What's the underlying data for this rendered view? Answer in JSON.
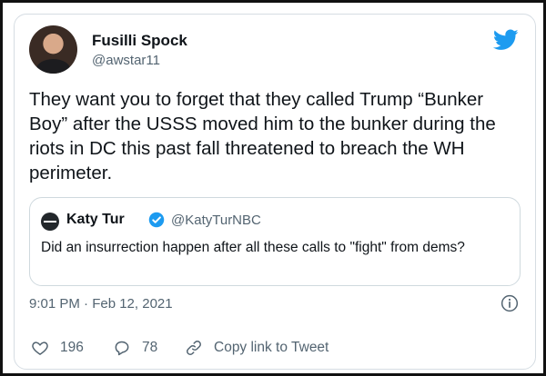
{
  "colors": {
    "brand": "#1d9bf0",
    "verified": "#1d9bf0",
    "secondary_text": "#536471",
    "border": "#cfd9de"
  },
  "tweet": {
    "author_name": "Fusilli Spock",
    "author_handle": "@awstar11",
    "avatar_icon": "avatar",
    "brand_icon": "twitter-bird-icon",
    "text": "They want you to forget that they called Trump “Bunker Boy” after the USSS moved him to the bunker during the riots in DC this past fall threatened to breach the WH perimeter.",
    "timestamp": "9:01 PM · Feb 12, 2021"
  },
  "quoted_tweet": {
    "author_name": "Katy Tur",
    "verified": true,
    "author_handle": "@KatyTurNBC",
    "text": "Did an insurrection happen after all these calls to \"fight\" from dems?"
  },
  "actions": {
    "like_count": "196",
    "reply_count": "78",
    "copy_link_label": "Copy link to Tweet"
  }
}
